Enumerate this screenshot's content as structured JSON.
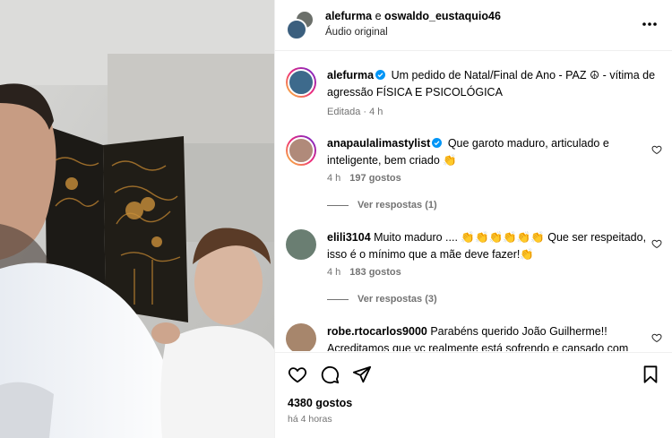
{
  "header": {
    "user1": "alefurma",
    "joiner": " e ",
    "user2": "oswaldo_eustaquio46",
    "subtitle": "Áudio original"
  },
  "caption": {
    "username": "alefurma",
    "text": "Um pedido de Natal/Final de Ano - PAZ ☮ - vítima de agressão FÍSICA E PSICOLÓGICA",
    "edited": "Editada",
    "time": "4 h"
  },
  "comments": [
    {
      "username": "anapaulalimastylist",
      "text": "Que garoto maduro, articulado e inteligente, bem criado 👏",
      "time": "4 h",
      "likes": "197 gostos",
      "replies": "Ver respostas (1)"
    },
    {
      "username": "elili3104",
      "text": "Muito maduro .... 👏👏👏👏👏👏 Que ser respeitado, isso é o mínimo que a mãe deve fazer!👏",
      "time": "4 h",
      "likes": "183 gostos",
      "replies": "Ver respostas (3)"
    },
    {
      "username": "robe.rtocarlos9000",
      "text": "Parabéns querido João Guilherme!! Acreditamos que vc realmente está sofrendo e cansado com",
      "time": "",
      "likes": "",
      "replies": ""
    }
  ],
  "footer": {
    "likes": "4380 gostos",
    "time": "há 4 horas"
  },
  "icons": {
    "more": "more-options-icon",
    "like": "heart-icon",
    "comment": "comment-icon",
    "share": "share-icon",
    "save": "bookmark-icon",
    "verified": "verified-badge-icon"
  },
  "colors": {
    "verified": "#0095f6",
    "muted": "#737373",
    "divider": "#efefef"
  }
}
